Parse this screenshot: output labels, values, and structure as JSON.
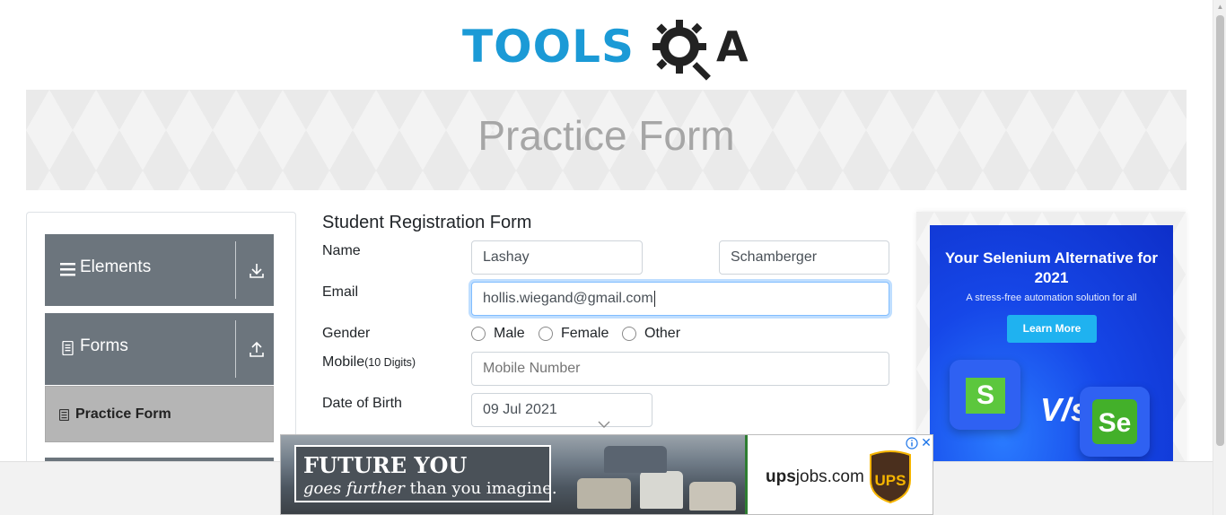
{
  "header": {
    "logo_text": "TOOLS",
    "logo_suffix": "A",
    "page_title": "Practice Form"
  },
  "sidebar": {
    "groups": [
      {
        "label": "Elements",
        "icon": "hamburger-icon",
        "arrow": "download-arrow-icon"
      },
      {
        "label": "Forms",
        "icon": "document-icon",
        "arrow": "upload-arrow-icon"
      }
    ],
    "active_item": {
      "label": "Practice Form",
      "icon": "form-icon"
    }
  },
  "form": {
    "title": "Student Registration Form",
    "name_label": "Name",
    "first_name": "Lashay",
    "last_name": "Schamberger",
    "email_label": "Email",
    "email": "hollis.wiegand@gmail.com",
    "gender_label": "Gender",
    "gender_options": [
      "Male",
      "Female",
      "Other"
    ],
    "mobile_label": "Mobile",
    "mobile_hint": "(10 Digits)",
    "mobile_placeholder": "Mobile Number",
    "dob_label": "Date of Birth",
    "dob_value": "09 Jul 2021"
  },
  "right_ad": {
    "headline": "Your Selenium Alternative for 2021",
    "subtext": "A stress-free automation solution for all",
    "button": "Learn More",
    "logo_left_letter": "S",
    "vs_text": "V/s",
    "logo_right_letter": "Se",
    "colors": {
      "background": "#1647e8",
      "button": "#1fb2f0",
      "green": "#5cc73d"
    }
  },
  "bottom_ad": {
    "line1": "FUTURE YOU",
    "line2_italic": "goes further",
    "line2_rest": " than you imagine.",
    "domain_bold": "ups",
    "domain_rest": "jobs.com",
    "brand": "UPS",
    "close": "✕"
  },
  "colors": {
    "accent_blue": "#1b9ad6",
    "sidebar_gray": "#6c757d",
    "active_item": "#b5b5b5",
    "focus_border": "#80bdff"
  }
}
